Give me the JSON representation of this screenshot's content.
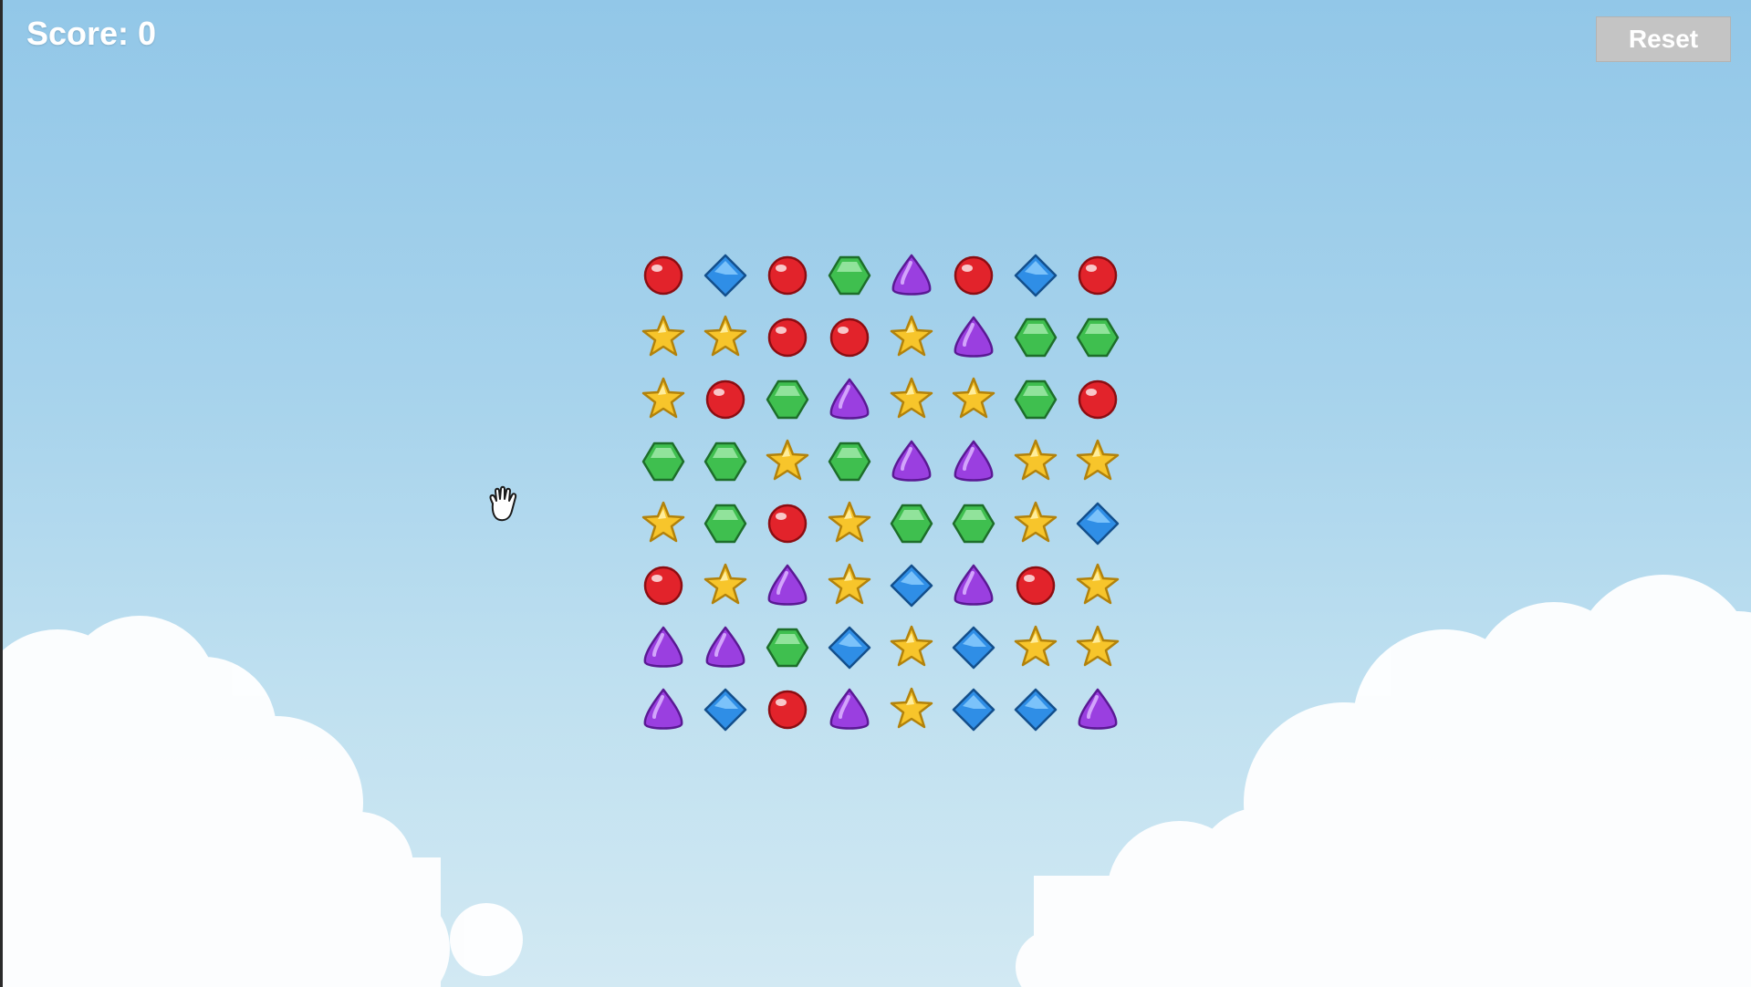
{
  "hud": {
    "score_text": "Score: 0",
    "reset_label": "Reset"
  },
  "colors": {
    "red": "#e2232b",
    "blue": "#2f8ee6",
    "green": "#3fbf4f",
    "purple": "#9a3fe0",
    "yellow": "#f7c52b"
  },
  "board": {
    "rows": 8,
    "cols": 8,
    "grid": [
      [
        "red",
        "blue",
        "red",
        "green",
        "purple",
        "red",
        "blue",
        "red"
      ],
      [
        "yellow",
        "yellow",
        "red",
        "red",
        "yellow",
        "purple",
        "green",
        "green"
      ],
      [
        "yellow",
        "red",
        "green",
        "purple",
        "yellow",
        "yellow",
        "green",
        "red"
      ],
      [
        "green",
        "green",
        "yellow",
        "green",
        "purple",
        "purple",
        "yellow",
        "yellow"
      ],
      [
        "yellow",
        "green",
        "red",
        "yellow",
        "green",
        "green",
        "yellow",
        "blue"
      ],
      [
        "red",
        "yellow",
        "purple",
        "yellow",
        "blue",
        "purple",
        "red",
        "yellow"
      ],
      [
        "purple",
        "purple",
        "green",
        "blue",
        "yellow",
        "blue",
        "yellow",
        "yellow"
      ],
      [
        "purple",
        "blue",
        "red",
        "purple",
        "yellow",
        "blue",
        "blue",
        "purple"
      ]
    ],
    "gem_icons": {
      "red": "red-orb-gem-icon",
      "blue": "blue-diamond-gem-icon",
      "green": "green-hexagon-gem-icon",
      "purple": "purple-drop-gem-icon",
      "yellow": "yellow-star-gem-icon"
    }
  },
  "cursor": {
    "icon": "grab-hand-cursor-icon"
  }
}
